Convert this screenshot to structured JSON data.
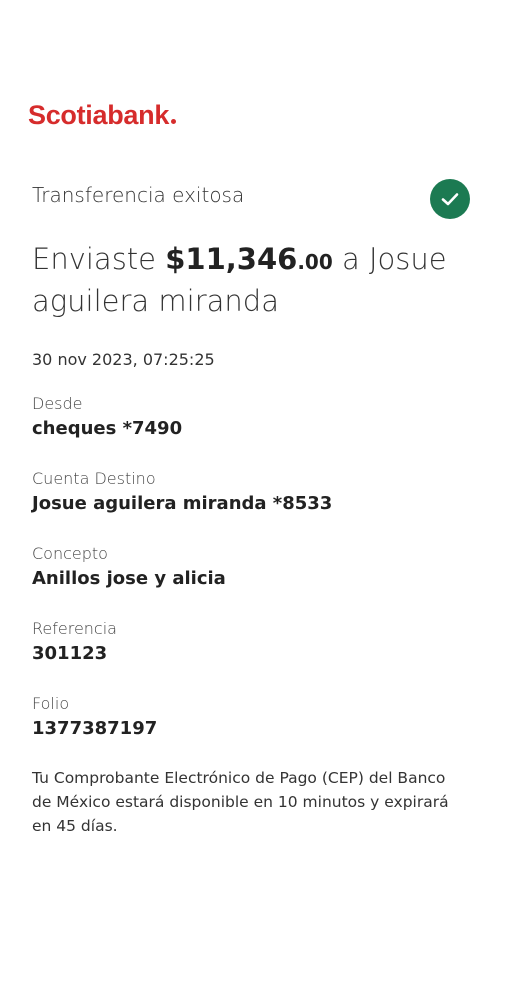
{
  "brand": {
    "name": "Scotiabank",
    "color": "#d62c2c"
  },
  "status": {
    "text": "Transferencia exitosa",
    "icon": "check-circle-icon",
    "color": "#1c7a52"
  },
  "headline": {
    "prefix": "Enviaste ",
    "amount": "$11,346",
    "cents": ".00",
    "suffix": " a Josue aguilera miranda"
  },
  "datetime": "30 nov 2023, 07:25:25",
  "details": [
    {
      "label": "Desde",
      "value": "cheques *7490"
    },
    {
      "label": "Cuenta Destino",
      "value": "Josue aguilera miranda *8533"
    },
    {
      "label": "Concepto",
      "value": "Anillos jose y alicia"
    },
    {
      "label": "Referencia",
      "value": "301123"
    },
    {
      "label": "Folio",
      "value": "1377387197"
    }
  ],
  "note": "Tu Comprobante Electrónico de Pago (CEP) del Banco de México estará disponible en 10 minutos y expirará en 45 días."
}
